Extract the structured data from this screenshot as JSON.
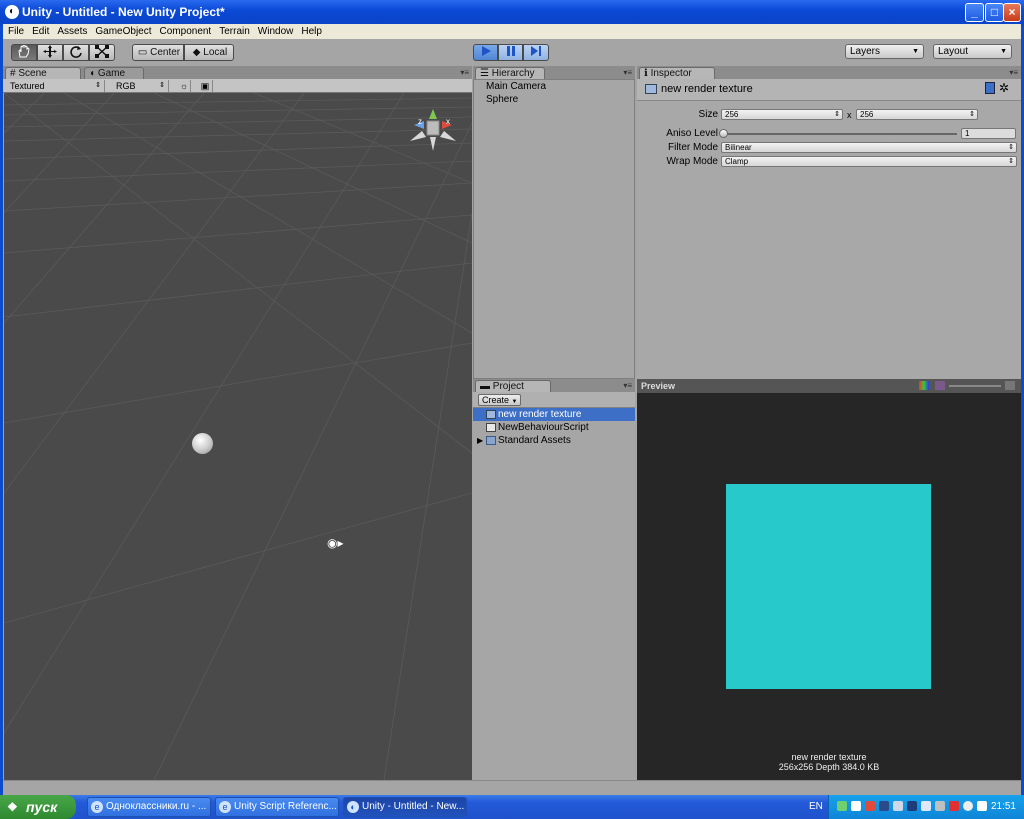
{
  "window": {
    "title": "Unity - Untitled - New Unity Project*",
    "min_icon": "minimize-icon",
    "max_icon": "maximize-icon",
    "close_icon": "close-icon"
  },
  "menu": [
    "File",
    "Edit",
    "Assets",
    "GameObject",
    "Component",
    "Terrain",
    "Window",
    "Help"
  ],
  "toolbar": {
    "tools": [
      "hand-icon",
      "move-icon",
      "rotate-icon",
      "scale-icon"
    ],
    "pivot_center": "Center",
    "pivot_local": "Local",
    "play_icon": "play-icon",
    "pause_icon": "pause-icon",
    "step_icon": "step-icon",
    "layers_label": "Layers",
    "layout_label": "Layout"
  },
  "scene": {
    "tab_scene": "Scene",
    "tab_game": "Game",
    "render_mode": "Textured",
    "color_mode": "RGB",
    "gizmo_x": "x",
    "gizmo_z": "z"
  },
  "hierarchy": {
    "tab": "Hierarchy",
    "items": [
      "Main Camera",
      "Sphere"
    ]
  },
  "project": {
    "tab": "Project",
    "create_label": "Create",
    "items": [
      {
        "label": "new render texture",
        "icon": "render-texture-icon",
        "selected": true
      },
      {
        "label": "NewBehaviourScript",
        "icon": "script-icon",
        "selected": false
      },
      {
        "label": "Standard Assets",
        "icon": "folder-icon",
        "selected": false
      }
    ]
  },
  "inspector": {
    "tab": "Inspector",
    "asset_name": "new render texture",
    "size_label": "Size",
    "size_width": "256",
    "size_x": "x",
    "size_height": "256",
    "aniso_label": "Aniso Level",
    "aniso_value": "1",
    "filter_label": "Filter Mode",
    "filter_value": "Bilinear",
    "wrap_label": "Wrap Mode",
    "wrap_value": "Clamp"
  },
  "preview": {
    "label": "Preview",
    "texture_color": "#28c9cb",
    "caption_name": "new render texture",
    "caption_info": "256x256  Depth  384.0 KB"
  },
  "taskbar": {
    "start_label": "пуск",
    "tasks": [
      {
        "label": "Одноклассники.ru - ...",
        "icon": "ie-icon",
        "active": false
      },
      {
        "label": "Unity Script Referenc...",
        "icon": "ie-icon",
        "active": false
      },
      {
        "label": "Unity - Untitled - New...",
        "icon": "unity-icon",
        "active": true
      }
    ],
    "lang": "EN",
    "clock": "21:51"
  }
}
